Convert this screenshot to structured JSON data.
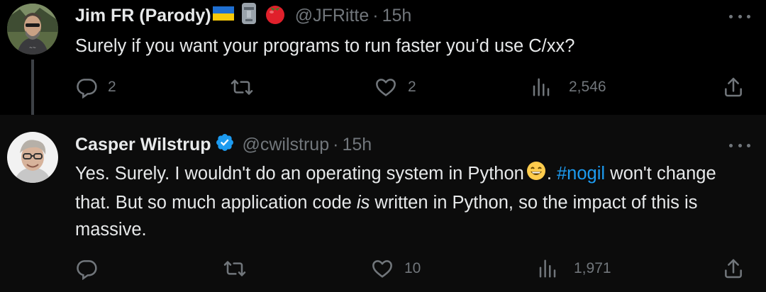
{
  "tweets": [
    {
      "author_name": "Jim FR (Parody)",
      "author_emojis": [
        "ukraine-flag",
        "moai",
        "tomato"
      ],
      "handle": "@JFRitte",
      "separator": "·",
      "time": "15h",
      "text": "Surely if you want your programs to run faster you’d use C/xx?",
      "replies": "2",
      "retweets": "",
      "likes": "2",
      "views": "2,546"
    },
    {
      "author_name": "Casper Wilstrup",
      "verified": true,
      "handle": "@cwilstrup",
      "separator": "·",
      "time": "15h",
      "text": {
        "part1": "Yes. Surely. I wouldn't do an operating system in Python",
        "emoji": "grinning-face-with-smiling-eyes",
        "part2": ". ",
        "hashtag": "#nogil",
        "part3": " won't change that. But so much application code ",
        "emphasis": "is",
        "part4": " written in Python, so the impact of this is massive."
      },
      "replies": "",
      "retweets": "",
      "likes": "10",
      "views": "1,971"
    }
  ],
  "colors": {
    "background": "#000000",
    "reply_background": "#0c0c0c",
    "text": "#e7e9ea",
    "secondary": "#71767b",
    "link": "#1d9bf0",
    "verified": "#1d9bf0",
    "thread_line": "#3d4146"
  }
}
